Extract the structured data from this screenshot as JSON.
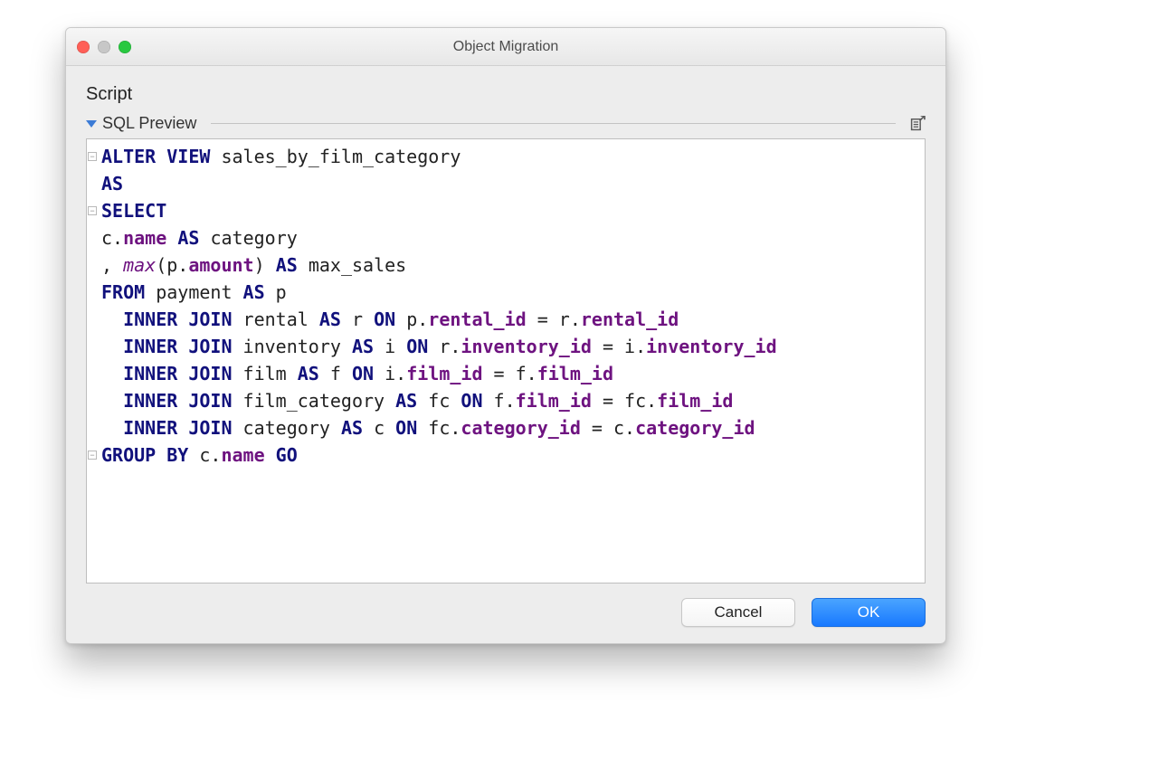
{
  "window": {
    "title": "Object Migration"
  },
  "panel": {
    "heading": "Script",
    "section": "SQL Preview"
  },
  "buttons": {
    "cancel": "Cancel",
    "ok": "OK"
  },
  "sql": {
    "tokens": [
      [
        [
          "kw",
          "ALTER VIEW"
        ],
        [
          "txt",
          " sales_by_film_category"
        ]
      ],
      [
        [
          "kw",
          "AS"
        ]
      ],
      [
        [
          "kw",
          "SELECT"
        ]
      ],
      [
        [
          "txt",
          "c."
        ],
        [
          "fld",
          "name"
        ],
        [
          "txt",
          " "
        ],
        [
          "kw",
          "AS"
        ],
        [
          "txt",
          " category"
        ]
      ],
      [
        [
          "txt",
          ", "
        ],
        [
          "func",
          "max"
        ],
        [
          "txt",
          "(p."
        ],
        [
          "fld",
          "amount"
        ],
        [
          "txt",
          ") "
        ],
        [
          "kw",
          "AS"
        ],
        [
          "txt",
          " max_sales"
        ]
      ],
      [
        [
          "kw",
          "FROM"
        ],
        [
          "txt",
          " payment "
        ],
        [
          "kw",
          "AS"
        ],
        [
          "txt",
          " p"
        ]
      ],
      [
        [
          "txt",
          "  "
        ],
        [
          "kw",
          "INNER JOIN"
        ],
        [
          "txt",
          " rental "
        ],
        [
          "kw",
          "AS"
        ],
        [
          "txt",
          " r "
        ],
        [
          "kw-on",
          "ON"
        ],
        [
          "txt",
          " p."
        ],
        [
          "fld",
          "rental_id"
        ],
        [
          "txt",
          " = r."
        ],
        [
          "fld",
          "rental_id"
        ]
      ],
      [
        [
          "txt",
          "  "
        ],
        [
          "kw",
          "INNER JOIN"
        ],
        [
          "txt",
          " inventory "
        ],
        [
          "kw",
          "AS"
        ],
        [
          "txt",
          " i "
        ],
        [
          "kw-on",
          "ON"
        ],
        [
          "txt",
          " r."
        ],
        [
          "fld",
          "inventory_id"
        ],
        [
          "txt",
          " = i."
        ],
        [
          "fld",
          "inventory_id"
        ]
      ],
      [
        [
          "txt",
          "  "
        ],
        [
          "kw",
          "INNER JOIN"
        ],
        [
          "txt",
          " film "
        ],
        [
          "kw",
          "AS"
        ],
        [
          "txt",
          " f "
        ],
        [
          "kw-on",
          "ON"
        ],
        [
          "txt",
          " i."
        ],
        [
          "fld",
          "film_id"
        ],
        [
          "txt",
          " = f."
        ],
        [
          "fld",
          "film_id"
        ]
      ],
      [
        [
          "txt",
          "  "
        ],
        [
          "kw",
          "INNER JOIN"
        ],
        [
          "txt",
          " film_category "
        ],
        [
          "kw",
          "AS"
        ],
        [
          "txt",
          " fc "
        ],
        [
          "kw-on",
          "ON"
        ],
        [
          "txt",
          " f."
        ],
        [
          "fld",
          "film_id"
        ],
        [
          "txt",
          " = fc."
        ],
        [
          "fld",
          "film_id"
        ]
      ],
      [
        [
          "txt",
          "  "
        ],
        [
          "kw",
          "INNER JOIN"
        ],
        [
          "txt",
          " category "
        ],
        [
          "kw",
          "AS"
        ],
        [
          "txt",
          " c "
        ],
        [
          "kw-on",
          "ON"
        ],
        [
          "txt",
          " fc."
        ],
        [
          "fld",
          "category_id"
        ],
        [
          "txt",
          " = c."
        ],
        [
          "fld",
          "category_id"
        ]
      ],
      [
        [
          "kw",
          "GROUP BY"
        ],
        [
          "txt",
          " c."
        ],
        [
          "fld",
          "name"
        ],
        [
          "txt",
          " "
        ],
        [
          "kw",
          "GO"
        ]
      ]
    ],
    "fold_markers": [
      0,
      2,
      11
    ]
  }
}
